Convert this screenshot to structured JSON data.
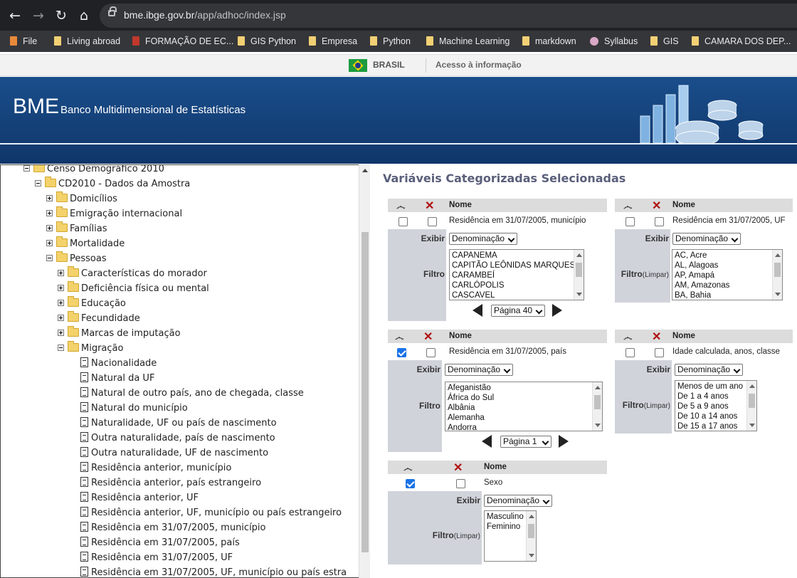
{
  "browser": {
    "url_host": "bme.ibge.gov.br",
    "url_path": "/app/adhoc/index.jsp",
    "bookmarks": [
      "File",
      "Living abroad",
      "FORMAÇÃO DE EC...",
      "GIS Python",
      "Empresa",
      "Python",
      "Machine Learning",
      "markdown",
      "Syllabus",
      "GIS",
      "CAMARA DOS DEP..."
    ]
  },
  "govbar": {
    "country": "BRASIL",
    "access": "Acesso à informação"
  },
  "banner": {
    "logo": "BME",
    "subtitle": "Banco Multidimensional de Estatísticas"
  },
  "tree": [
    {
      "label": "Censo Demográfico 2010",
      "kind": "open"
    },
    {
      "label": "CD2010 - Dados da Amostra",
      "kind": "open"
    },
    {
      "label": "Domicílios",
      "kind": "closed"
    },
    {
      "label": "Emigração internacional",
      "kind": "closed"
    },
    {
      "label": "Famílias",
      "kind": "closed"
    },
    {
      "label": "Mortalidade",
      "kind": "closed"
    },
    {
      "label": "Pessoas",
      "kind": "open"
    },
    {
      "label": "Características do morador",
      "kind": "closed"
    },
    {
      "label": "Deficiência física ou mental",
      "kind": "closed"
    },
    {
      "label": "Educação",
      "kind": "closed"
    },
    {
      "label": "Fecundidade",
      "kind": "closed"
    },
    {
      "label": "Marcas de imputação",
      "kind": "closed"
    },
    {
      "label": "Migração",
      "kind": "open"
    },
    {
      "label": "Nacionalidade",
      "kind": "doc"
    },
    {
      "label": "Natural da UF",
      "kind": "doc"
    },
    {
      "label": "Natural de outro país, ano de chegada, classe",
      "kind": "doc"
    },
    {
      "label": "Natural do município",
      "kind": "doc"
    },
    {
      "label": "Naturalidade, UF ou país de nascimento",
      "kind": "doc"
    },
    {
      "label": "Outra naturalidade, país de nascimento",
      "kind": "doc"
    },
    {
      "label": "Outra naturalidade, UF de nascimento",
      "kind": "doc"
    },
    {
      "label": "Residência anterior, município",
      "kind": "doc"
    },
    {
      "label": "Residência anterior, país estrangeiro",
      "kind": "doc"
    },
    {
      "label": "Residência anterior, UF",
      "kind": "doc"
    },
    {
      "label": "Residência anterior, UF, município ou país estrangeiro",
      "kind": "doc"
    },
    {
      "label": "Residência em 31/07/2005, município",
      "kind": "doc"
    },
    {
      "label": "Residência em 31/07/2005, país",
      "kind": "doc"
    },
    {
      "label": "Residência em 31/07/2005, UF",
      "kind": "doc"
    },
    {
      "label": "Residência em 31/07/2005, UF, município ou país estra",
      "kind": "doc"
    }
  ],
  "main": {
    "heading": "Variáveis Categorizadas Selecionadas",
    "col_name": "Nome",
    "exibir_label": "Exibir",
    "filtro_label": "Filtro",
    "limpar_label": "(Limpar)",
    "panels": [
      {
        "name": "Residência em 31/07/2005, município",
        "selected": false,
        "exibir": "Denominação",
        "items": [
          "CAPANEMA",
          "CAPITÃO LEÔNIDAS MARQUES",
          "CARAMBEÍ",
          "CARLÓPOLIS",
          "CASCAVEL"
        ],
        "page": "Página 40"
      },
      {
        "name": "Residência em 31/07/2005, UF",
        "selected": false,
        "exibir": "Denominação",
        "items": [
          "AC, Acre",
          "AL, Alagoas",
          "AP, Amapá",
          "AM, Amazonas",
          "BA, Bahia"
        ]
      },
      {
        "name": "Residência em 31/07/2005, país",
        "selected": true,
        "exibir": "Denominação",
        "items": [
          "Afeganistão",
          "África do Sul",
          "Albânia",
          "Alemanha",
          "Andorra"
        ],
        "page": "Página 1"
      },
      {
        "name": "Idade calculada, anos, classe",
        "selected": false,
        "exibir": "Denominação",
        "items": [
          "Menos de um ano",
          "De 1 a 4 anos",
          "De 5 a 9 anos",
          "De 10 a 14 anos",
          "De 15 a 17 anos"
        ]
      },
      {
        "name": "Sexo",
        "selected": true,
        "exibir": "Denominação",
        "items": [
          "Masculino",
          "Feminino"
        ]
      }
    ]
  }
}
